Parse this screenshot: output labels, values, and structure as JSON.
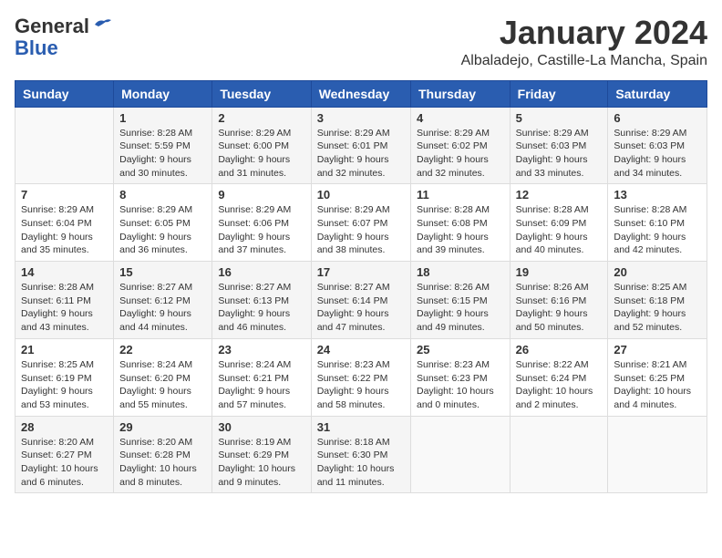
{
  "header": {
    "logo_general": "General",
    "logo_blue": "Blue",
    "month_year": "January 2024",
    "location": "Albaladejo, Castille-La Mancha, Spain"
  },
  "weekdays": [
    "Sunday",
    "Monday",
    "Tuesday",
    "Wednesday",
    "Thursday",
    "Friday",
    "Saturday"
  ],
  "weeks": [
    [
      {
        "day": "",
        "sunrise": "",
        "sunset": "",
        "daylight": ""
      },
      {
        "day": "1",
        "sunrise": "Sunrise: 8:28 AM",
        "sunset": "Sunset: 5:59 PM",
        "daylight": "Daylight: 9 hours and 30 minutes."
      },
      {
        "day": "2",
        "sunrise": "Sunrise: 8:29 AM",
        "sunset": "Sunset: 6:00 PM",
        "daylight": "Daylight: 9 hours and 31 minutes."
      },
      {
        "day": "3",
        "sunrise": "Sunrise: 8:29 AM",
        "sunset": "Sunset: 6:01 PM",
        "daylight": "Daylight: 9 hours and 32 minutes."
      },
      {
        "day": "4",
        "sunrise": "Sunrise: 8:29 AM",
        "sunset": "Sunset: 6:02 PM",
        "daylight": "Daylight: 9 hours and 32 minutes."
      },
      {
        "day": "5",
        "sunrise": "Sunrise: 8:29 AM",
        "sunset": "Sunset: 6:03 PM",
        "daylight": "Daylight: 9 hours and 33 minutes."
      },
      {
        "day": "6",
        "sunrise": "Sunrise: 8:29 AM",
        "sunset": "Sunset: 6:03 PM",
        "daylight": "Daylight: 9 hours and 34 minutes."
      }
    ],
    [
      {
        "day": "7",
        "sunrise": "Sunrise: 8:29 AM",
        "sunset": "Sunset: 6:04 PM",
        "daylight": "Daylight: 9 hours and 35 minutes."
      },
      {
        "day": "8",
        "sunrise": "Sunrise: 8:29 AM",
        "sunset": "Sunset: 6:05 PM",
        "daylight": "Daylight: 9 hours and 36 minutes."
      },
      {
        "day": "9",
        "sunrise": "Sunrise: 8:29 AM",
        "sunset": "Sunset: 6:06 PM",
        "daylight": "Daylight: 9 hours and 37 minutes."
      },
      {
        "day": "10",
        "sunrise": "Sunrise: 8:29 AM",
        "sunset": "Sunset: 6:07 PM",
        "daylight": "Daylight: 9 hours and 38 minutes."
      },
      {
        "day": "11",
        "sunrise": "Sunrise: 8:28 AM",
        "sunset": "Sunset: 6:08 PM",
        "daylight": "Daylight: 9 hours and 39 minutes."
      },
      {
        "day": "12",
        "sunrise": "Sunrise: 8:28 AM",
        "sunset": "Sunset: 6:09 PM",
        "daylight": "Daylight: 9 hours and 40 minutes."
      },
      {
        "day": "13",
        "sunrise": "Sunrise: 8:28 AM",
        "sunset": "Sunset: 6:10 PM",
        "daylight": "Daylight: 9 hours and 42 minutes."
      }
    ],
    [
      {
        "day": "14",
        "sunrise": "Sunrise: 8:28 AM",
        "sunset": "Sunset: 6:11 PM",
        "daylight": "Daylight: 9 hours and 43 minutes."
      },
      {
        "day": "15",
        "sunrise": "Sunrise: 8:27 AM",
        "sunset": "Sunset: 6:12 PM",
        "daylight": "Daylight: 9 hours and 44 minutes."
      },
      {
        "day": "16",
        "sunrise": "Sunrise: 8:27 AM",
        "sunset": "Sunset: 6:13 PM",
        "daylight": "Daylight: 9 hours and 46 minutes."
      },
      {
        "day": "17",
        "sunrise": "Sunrise: 8:27 AM",
        "sunset": "Sunset: 6:14 PM",
        "daylight": "Daylight: 9 hours and 47 minutes."
      },
      {
        "day": "18",
        "sunrise": "Sunrise: 8:26 AM",
        "sunset": "Sunset: 6:15 PM",
        "daylight": "Daylight: 9 hours and 49 minutes."
      },
      {
        "day": "19",
        "sunrise": "Sunrise: 8:26 AM",
        "sunset": "Sunset: 6:16 PM",
        "daylight": "Daylight: 9 hours and 50 minutes."
      },
      {
        "day": "20",
        "sunrise": "Sunrise: 8:25 AM",
        "sunset": "Sunset: 6:18 PM",
        "daylight": "Daylight: 9 hours and 52 minutes."
      }
    ],
    [
      {
        "day": "21",
        "sunrise": "Sunrise: 8:25 AM",
        "sunset": "Sunset: 6:19 PM",
        "daylight": "Daylight: 9 hours and 53 minutes."
      },
      {
        "day": "22",
        "sunrise": "Sunrise: 8:24 AM",
        "sunset": "Sunset: 6:20 PM",
        "daylight": "Daylight: 9 hours and 55 minutes."
      },
      {
        "day": "23",
        "sunrise": "Sunrise: 8:24 AM",
        "sunset": "Sunset: 6:21 PM",
        "daylight": "Daylight: 9 hours and 57 minutes."
      },
      {
        "day": "24",
        "sunrise": "Sunrise: 8:23 AM",
        "sunset": "Sunset: 6:22 PM",
        "daylight": "Daylight: 9 hours and 58 minutes."
      },
      {
        "day": "25",
        "sunrise": "Sunrise: 8:23 AM",
        "sunset": "Sunset: 6:23 PM",
        "daylight": "Daylight: 10 hours and 0 minutes."
      },
      {
        "day": "26",
        "sunrise": "Sunrise: 8:22 AM",
        "sunset": "Sunset: 6:24 PM",
        "daylight": "Daylight: 10 hours and 2 minutes."
      },
      {
        "day": "27",
        "sunrise": "Sunrise: 8:21 AM",
        "sunset": "Sunset: 6:25 PM",
        "daylight": "Daylight: 10 hours and 4 minutes."
      }
    ],
    [
      {
        "day": "28",
        "sunrise": "Sunrise: 8:20 AM",
        "sunset": "Sunset: 6:27 PM",
        "daylight": "Daylight: 10 hours and 6 minutes."
      },
      {
        "day": "29",
        "sunrise": "Sunrise: 8:20 AM",
        "sunset": "Sunset: 6:28 PM",
        "daylight": "Daylight: 10 hours and 8 minutes."
      },
      {
        "day": "30",
        "sunrise": "Sunrise: 8:19 AM",
        "sunset": "Sunset: 6:29 PM",
        "daylight": "Daylight: 10 hours and 9 minutes."
      },
      {
        "day": "31",
        "sunrise": "Sunrise: 8:18 AM",
        "sunset": "Sunset: 6:30 PM",
        "daylight": "Daylight: 10 hours and 11 minutes."
      },
      {
        "day": "",
        "sunrise": "",
        "sunset": "",
        "daylight": ""
      },
      {
        "day": "",
        "sunrise": "",
        "sunset": "",
        "daylight": ""
      },
      {
        "day": "",
        "sunrise": "",
        "sunset": "",
        "daylight": ""
      }
    ]
  ]
}
